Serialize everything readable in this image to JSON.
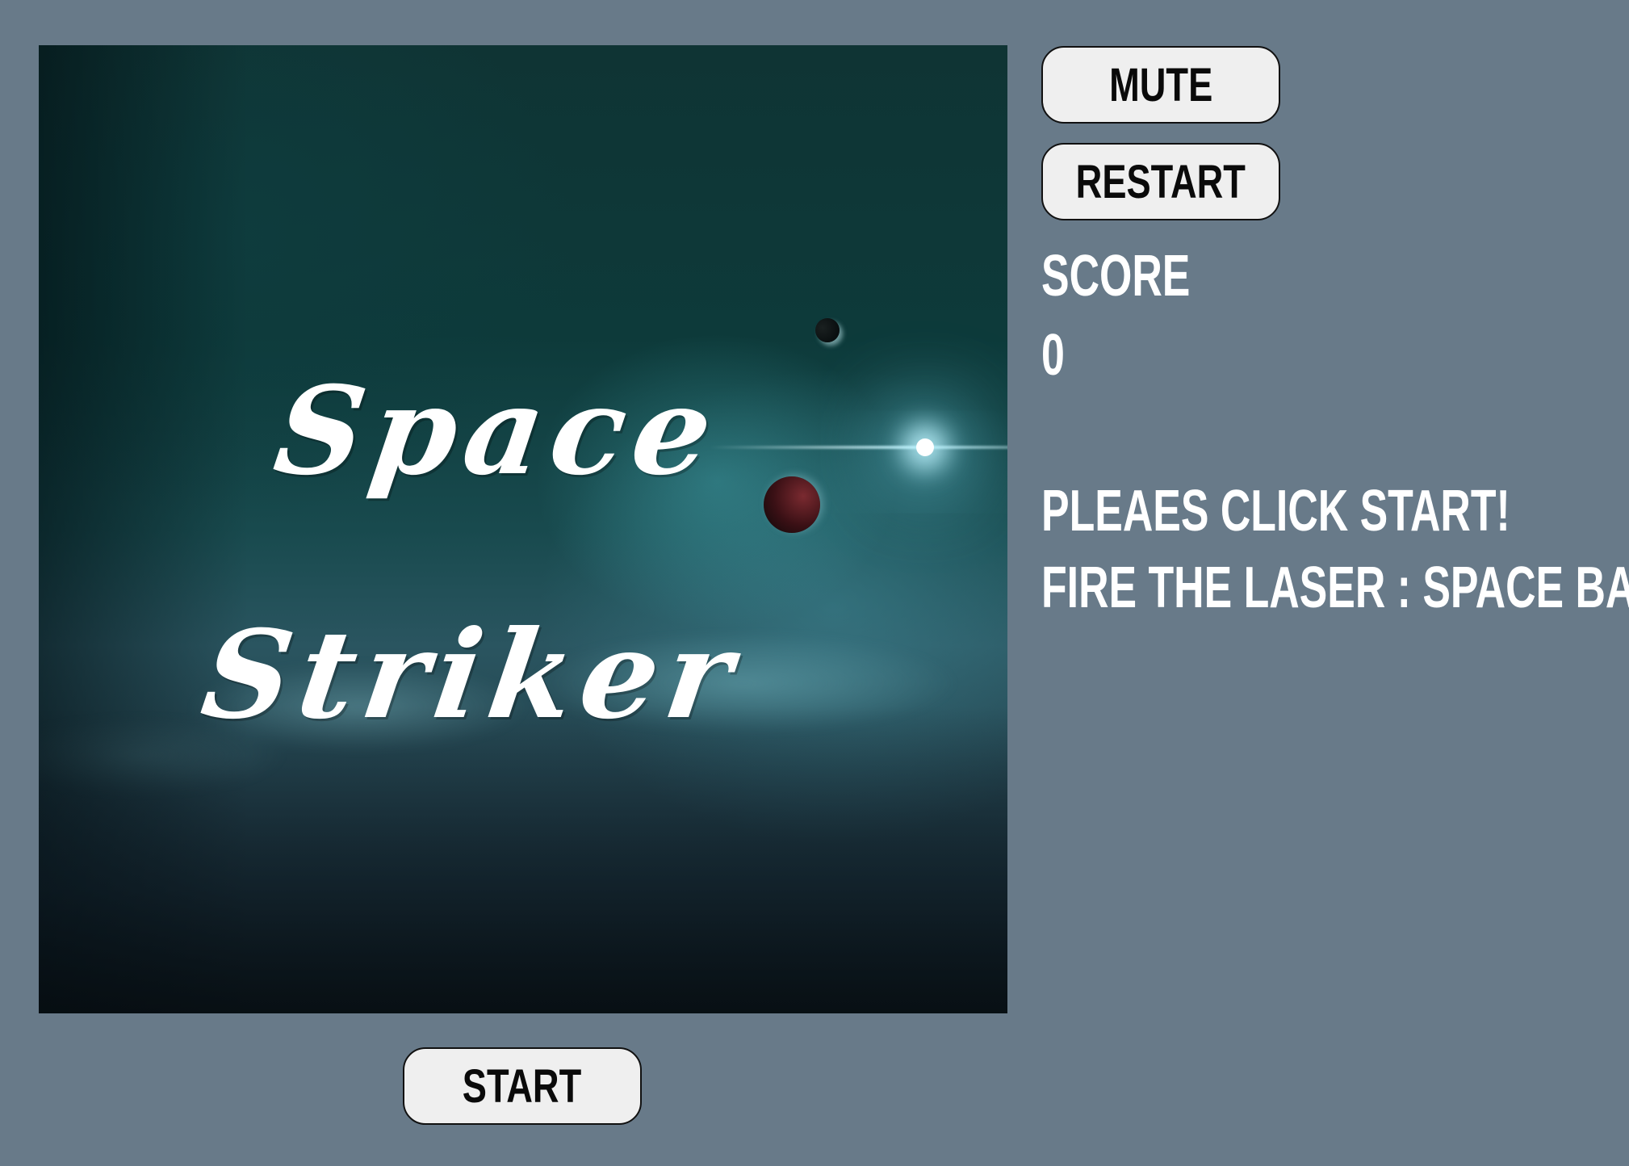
{
  "game": {
    "title_line_1": "Space",
    "title_line_2": "Striker"
  },
  "controls": {
    "mute_label": "MUTE",
    "restart_label": "RESTART",
    "start_label": "START"
  },
  "scoreboard": {
    "label": "SCORE",
    "value": "0"
  },
  "messages": {
    "prompt": "PLEAES CLICK START!",
    "instructions": "FIRE THE LASER : SPACE BAR"
  },
  "colors": {
    "page_background": "#687a89",
    "button_background": "#efefef",
    "text": "#ffffff"
  }
}
